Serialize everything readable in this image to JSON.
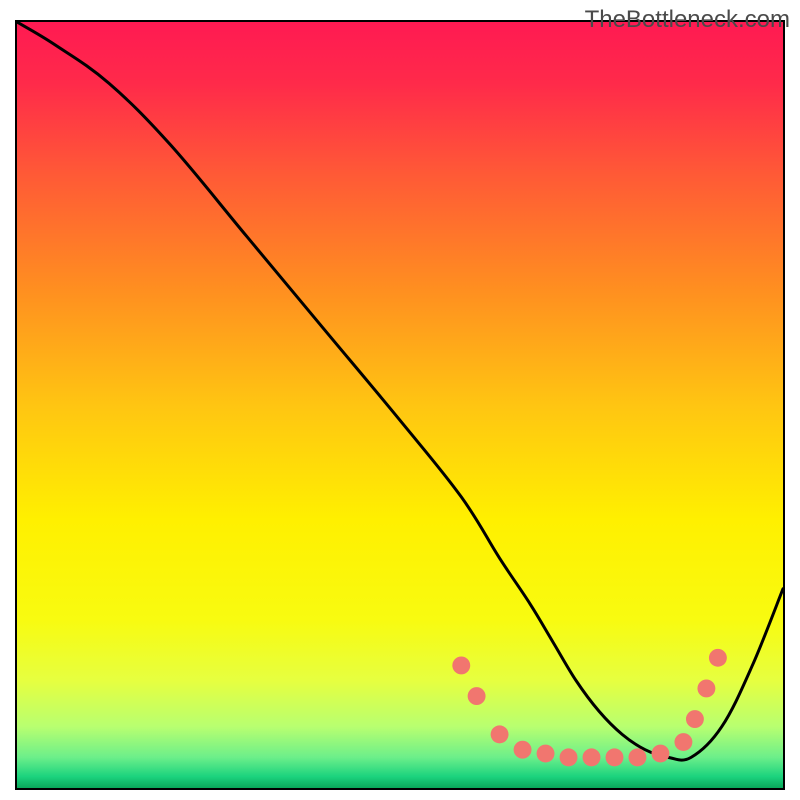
{
  "watermark": "TheBottleneck.com",
  "gradient": {
    "stops": [
      {
        "offset": 0.0,
        "color": "#ff1a52"
      },
      {
        "offset": 0.08,
        "color": "#ff2a4a"
      },
      {
        "offset": 0.2,
        "color": "#ff5a36"
      },
      {
        "offset": 0.35,
        "color": "#ff8f20"
      },
      {
        "offset": 0.5,
        "color": "#ffc512"
      },
      {
        "offset": 0.65,
        "color": "#fff000"
      },
      {
        "offset": 0.78,
        "color": "#f8fb10"
      },
      {
        "offset": 0.86,
        "color": "#e6ff40"
      },
      {
        "offset": 0.92,
        "color": "#b8ff70"
      },
      {
        "offset": 0.96,
        "color": "#6cef8a"
      },
      {
        "offset": 0.985,
        "color": "#1cd37e"
      },
      {
        "offset": 1.0,
        "color": "#0aa85a"
      }
    ]
  },
  "chart_data": {
    "type": "line",
    "title": "",
    "xlabel": "",
    "ylabel": "",
    "xlim": [
      0,
      100
    ],
    "ylim": [
      0,
      100
    ],
    "series": [
      {
        "name": "bottleneck-curve",
        "x": [
          0,
          5,
          12,
          20,
          30,
          40,
          50,
          58,
          63,
          67,
          70,
          73,
          76,
          79,
          82,
          85,
          88,
          92,
          96,
          100
        ],
        "y": [
          100,
          97,
          92,
          84,
          72,
          60,
          48,
          38,
          30,
          24,
          19,
          14,
          10,
          7,
          5,
          4,
          4,
          8,
          16,
          26
        ]
      }
    ],
    "markers": {
      "name": "highlight-dots",
      "color": "#f1766f",
      "points": [
        {
          "x": 58,
          "y": 16
        },
        {
          "x": 60,
          "y": 12
        },
        {
          "x": 63,
          "y": 7
        },
        {
          "x": 66,
          "y": 5
        },
        {
          "x": 69,
          "y": 4.5
        },
        {
          "x": 72,
          "y": 4
        },
        {
          "x": 75,
          "y": 4
        },
        {
          "x": 78,
          "y": 4
        },
        {
          "x": 81,
          "y": 4
        },
        {
          "x": 84,
          "y": 4.5
        },
        {
          "x": 87,
          "y": 6
        },
        {
          "x": 88.5,
          "y": 9
        },
        {
          "x": 90,
          "y": 13
        },
        {
          "x": 91.5,
          "y": 17
        }
      ]
    }
  }
}
